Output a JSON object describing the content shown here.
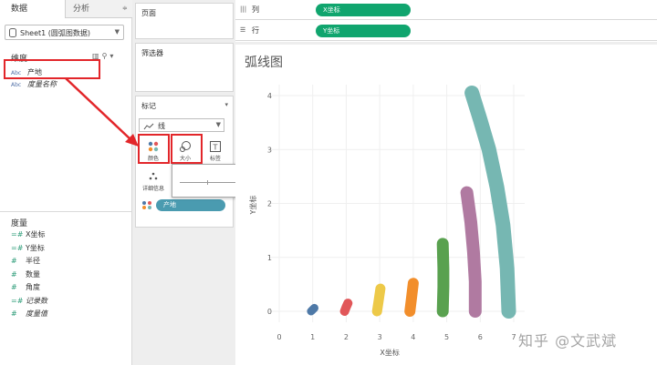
{
  "data_pane": {
    "tab_data": "数据",
    "tab_analytics": "分析",
    "tab_menu": "≑",
    "source": "Sheet1 (圆弧图数据)",
    "dimensions_header": "维度",
    "dimensions": [
      {
        "type": "Abc",
        "name": "产地",
        "italic": false
      },
      {
        "type": "Abc",
        "name": "度量名称",
        "italic": true
      }
    ],
    "measures_header": "度量",
    "measures": [
      {
        "prefix": "=#",
        "name": "X坐标",
        "italic": false
      },
      {
        "prefix": "=#",
        "name": "Y坐标",
        "italic": false
      },
      {
        "prefix": "#",
        "name": "半径",
        "italic": false
      },
      {
        "prefix": "#",
        "name": "数量",
        "italic": false
      },
      {
        "prefix": "#",
        "name": "角度",
        "italic": false
      },
      {
        "prefix": "=#",
        "name": "记录数",
        "italic": true
      },
      {
        "prefix": "#",
        "name": "度量值",
        "italic": true
      }
    ]
  },
  "cards": {
    "pages": "页面",
    "filters": "筛选器",
    "marks": "标记",
    "mark_type": "线",
    "color_button": "颜色",
    "size_button": "大小",
    "label_button": "标签",
    "detail_button": "详细信息",
    "color_pill": "产地"
  },
  "shelves": {
    "columns_label": "列",
    "columns_pill": "X坐标",
    "rows_label": "行",
    "rows_pill": "Y坐标"
  },
  "viz": {
    "title": "弧线图",
    "watermark": "知乎 @文武斌"
  },
  "chart_data": {
    "type": "line",
    "xlabel": "X坐标",
    "ylabel": "Y坐标",
    "xlim": [
      0,
      7
    ],
    "ylim": [
      0,
      4
    ],
    "x_ticks": [
      0,
      1,
      2,
      3,
      4,
      5,
      6,
      7
    ],
    "y_ticks": [
      0,
      1,
      2,
      3,
      4
    ],
    "grid": true,
    "series": [
      {
        "color": "#4e79a7",
        "stroke": 9,
        "points": [
          [
            0.95,
            0
          ],
          [
            1.0,
            0.03
          ],
          [
            1.05,
            0.06
          ]
        ]
      },
      {
        "color": "#e15759",
        "stroke": 10,
        "points": [
          [
            1.95,
            0
          ],
          [
            2.0,
            0.08
          ],
          [
            2.05,
            0.15
          ]
        ]
      },
      {
        "color": "#edc948",
        "stroke": 11,
        "points": [
          [
            2.92,
            0
          ],
          [
            2.97,
            0.2
          ],
          [
            3.02,
            0.42
          ]
        ]
      },
      {
        "color": "#f28e2b",
        "stroke": 12,
        "points": [
          [
            3.9,
            0
          ],
          [
            3.95,
            0.25
          ],
          [
            4.0,
            0.52
          ]
        ]
      },
      {
        "color": "#59a14f",
        "stroke": 13,
        "points": [
          [
            4.88,
            0
          ],
          [
            4.9,
            0.45
          ],
          [
            4.9,
            0.8
          ],
          [
            4.88,
            1.25
          ]
        ]
      },
      {
        "color": "#b07aa1",
        "stroke": 14,
        "points": [
          [
            5.85,
            0
          ],
          [
            5.85,
            0.55
          ],
          [
            5.8,
            1.1
          ],
          [
            5.72,
            1.65
          ],
          [
            5.6,
            2.2
          ]
        ]
      },
      {
        "color": "#76b7b2",
        "stroke": 16,
        "points": [
          [
            6.85,
            0
          ],
          [
            6.8,
            0.8
          ],
          [
            6.68,
            1.6
          ],
          [
            6.5,
            2.3
          ],
          [
            6.26,
            3.0
          ],
          [
            6.0,
            3.55
          ],
          [
            5.75,
            4.05
          ]
        ]
      }
    ]
  }
}
